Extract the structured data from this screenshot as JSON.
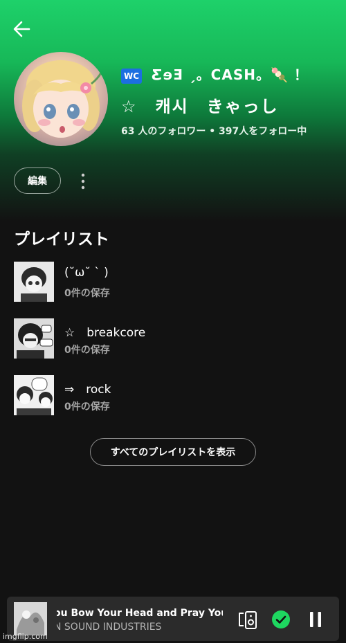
{
  "profile": {
    "badge": "🚾",
    "name_line1": "ƸɘƎ ˏ。CASH。🍡 ！",
    "name_line2": "☆　캐시　きゃっし",
    "followers": "63 人のフォロワー • 397人をフォロー中",
    "edit_label": "編集"
  },
  "playlists_section": {
    "title": "プレイリスト",
    "items": [
      {
        "name": "(˘ω˘ ` )",
        "saves": "0件の保存"
      },
      {
        "name": "☆　breakcore",
        "saves": "0件の保存"
      },
      {
        "name": "⇒　rock",
        "saves": "0件の保存"
      }
    ],
    "show_all_label": "すべてのプレイリストを表示"
  },
  "now_playing": {
    "title": "ou Bow Your Head and Pray You",
    "artist": "N SOUND INDUSTRIES",
    "is_playing": true,
    "is_saved": true
  },
  "colors": {
    "accent": "#1ed760",
    "header_gradient_top": "#1ed16a",
    "background": "#121212",
    "player_bg": "#2b2b2b"
  },
  "icons": {
    "back": "arrow-left-icon",
    "more": "vertical-dots-icon",
    "device": "speaker-device-icon",
    "saved": "check-circle-icon",
    "pause": "pause-icon"
  },
  "watermark": "imgflip.com"
}
